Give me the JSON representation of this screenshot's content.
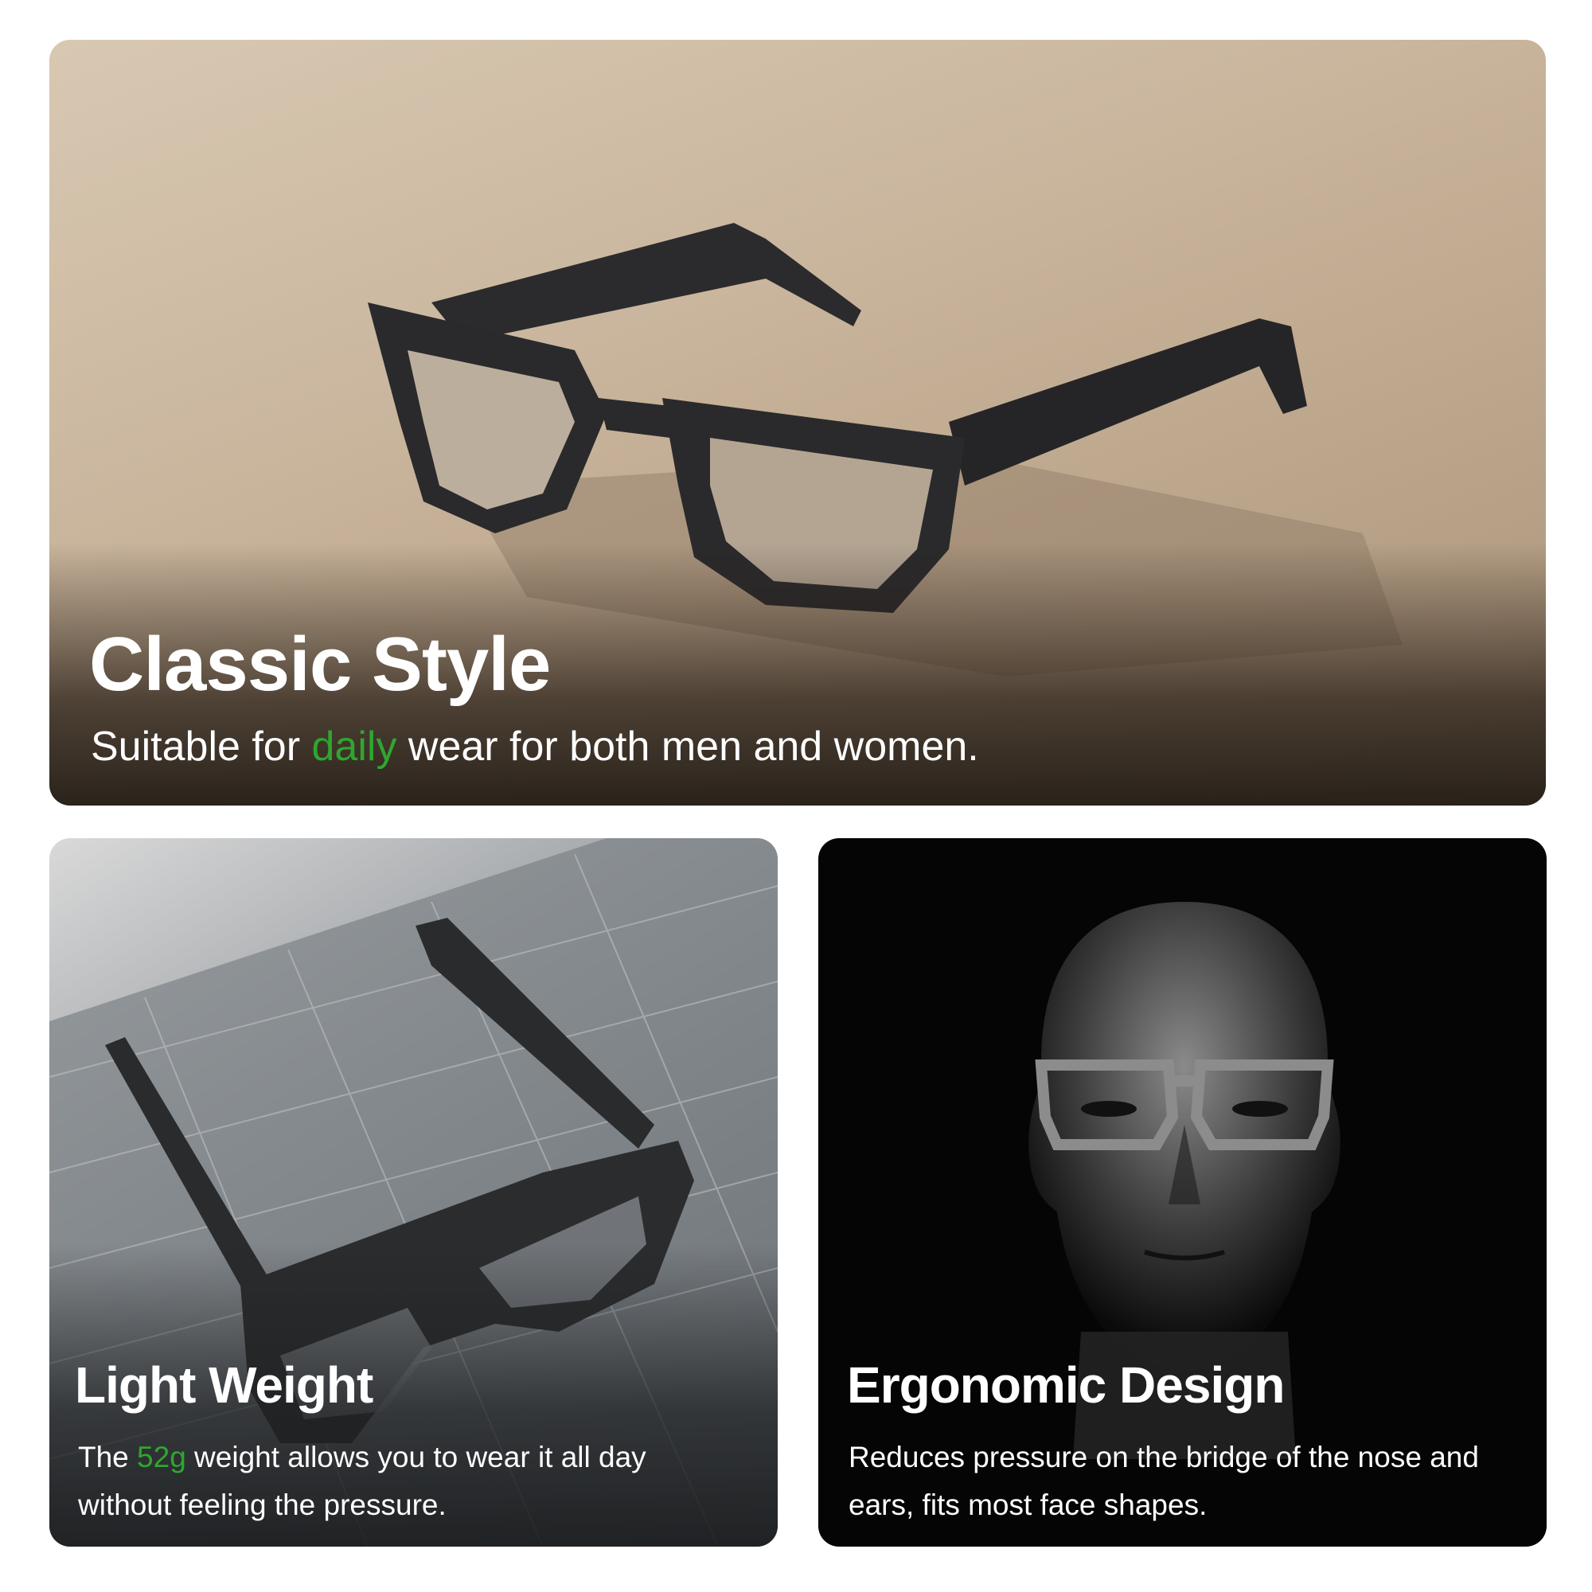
{
  "panels": {
    "classic": {
      "title": "Classic Style",
      "desc_before": "Suitable for ",
      "desc_highlight": "daily",
      "desc_after": " wear for both men and women.",
      "image": "glasses-on-beige-surface"
    },
    "light": {
      "title": "Light Weight",
      "desc_before": "The ",
      "desc_highlight": "52g",
      "desc_after": " weight allows you to wear it all day without feeling the pressure.",
      "image": "glasses-on-cutting-mat"
    },
    "ergonomic": {
      "title": "Ergonomic Design",
      "desc": "Reduces pressure on the bridge of the nose and ears, fits most face shapes.",
      "image": "head-wearing-glasses"
    }
  },
  "colors": {
    "highlight": "#2fa62f",
    "text": "#ffffff",
    "dark_panel": "#050505"
  }
}
